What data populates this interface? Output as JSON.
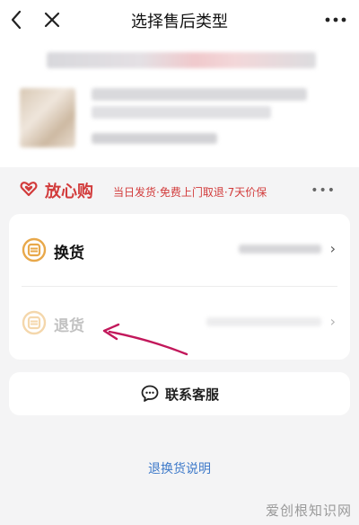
{
  "nav": {
    "title": "选择售后类型",
    "back_icon": "chevron-left-icon",
    "close_icon": "close-icon",
    "more_icon": "more-dots-icon"
  },
  "assurance": {
    "brand": "放心购",
    "tags": "当日发货·免费上门取退·7天价保",
    "more": "•••",
    "color": "#d23b3b"
  },
  "types": {
    "exchange_label": "换货",
    "return_label": "退货",
    "chevron": "›",
    "icon_color": "#e8a84a"
  },
  "service": {
    "label": "联系客服"
  },
  "explain": {
    "label": "退换货说明"
  },
  "watermark": "爱创根知识网",
  "annotation": {
    "arrow_color": "#c2185b"
  }
}
